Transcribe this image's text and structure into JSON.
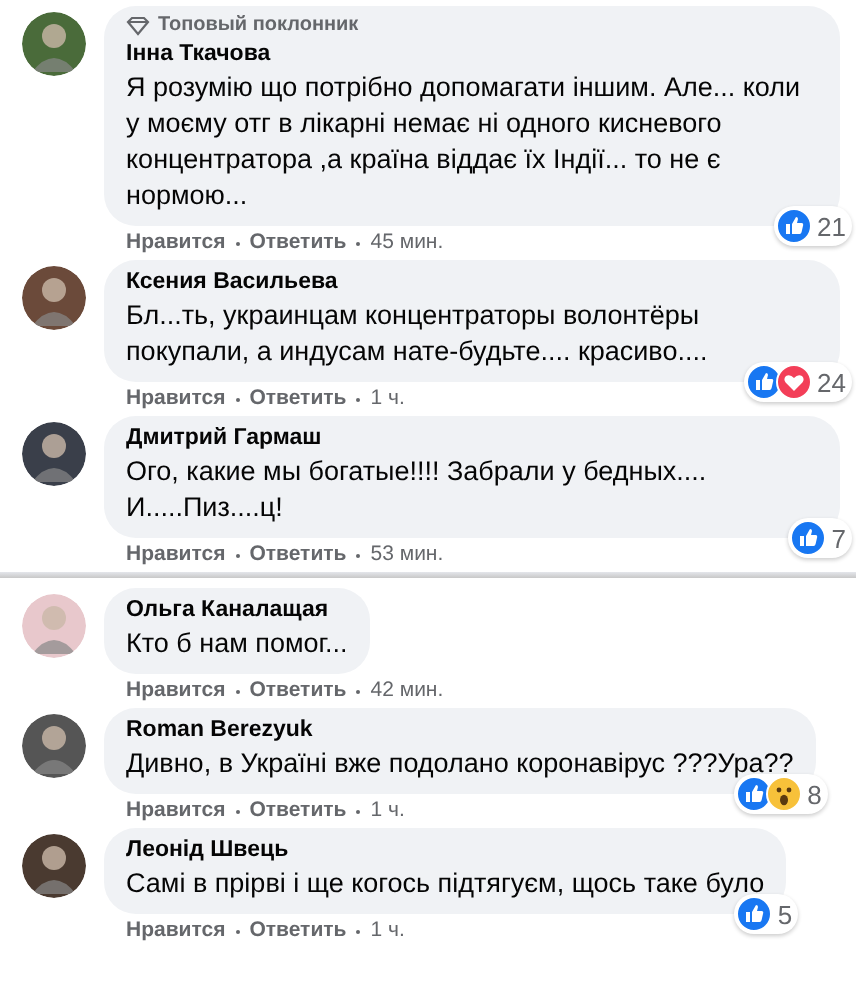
{
  "sections": [
    {
      "comments": [
        {
          "badge": "Топовый поклонник",
          "author": "Інна Ткачова",
          "text": "Я розумію що потрібно допомагати іншим. Але... коли у моєму отг в лікарні немає ні одного кисневого концентратора ,а країна віддає їх Індії... то не є нормою...",
          "reactions": [
            {
              "kind": "like"
            }
          ],
          "count": "21",
          "like": "Нравится",
          "reply": "Ответить",
          "time": "45 мин."
        },
        {
          "author": "Ксения Васильева",
          "text": "Бл...ть, украинцам концентраторы волонтёры покупали, а индусам нате-будьте.... красиво....",
          "reactions": [
            {
              "kind": "like"
            },
            {
              "kind": "love"
            }
          ],
          "count": "24",
          "like": "Нравится",
          "reply": "Ответить",
          "time": "1 ч."
        },
        {
          "author": "Дмитрий Гармаш",
          "text": "Ого, какие мы богатые!!!! Забрали у бедных.... И.....Пиз....ц!",
          "reactions": [
            {
              "kind": "like"
            }
          ],
          "count": "7",
          "like": "Нравится",
          "reply": "Ответить",
          "time": "53 мин."
        }
      ]
    },
    {
      "comments": [
        {
          "author": "Ольга Каналащая",
          "text": "Кто б нам помог...",
          "like": "Нравится",
          "reply": "Ответить",
          "time": "42 мин."
        },
        {
          "author": "Roman Berezyuk",
          "text": "Дивно, в Україні вже подолано коронавірус ???Ура??",
          "reactions": [
            {
              "kind": "like"
            },
            {
              "kind": "wow"
            }
          ],
          "count": "8",
          "like": "Нравится",
          "reply": "Ответить",
          "time": "1 ч."
        },
        {
          "author": "Леонід Швець",
          "text": "Самі в прірві і ще когось підтягуєм, щось таке було",
          "reactions": [
            {
              "kind": "like"
            }
          ],
          "count": "5",
          "like": "Нравится",
          "reply": "Ответить",
          "time": "1 ч."
        }
      ]
    }
  ]
}
